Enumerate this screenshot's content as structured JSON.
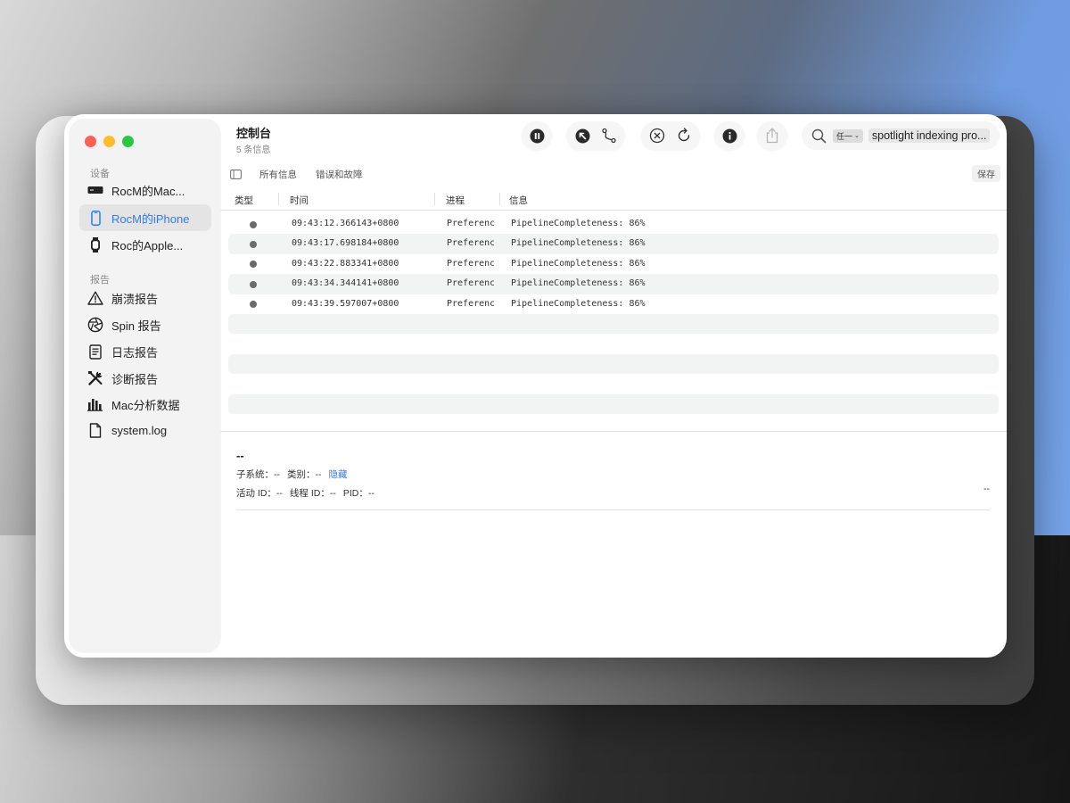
{
  "window": {
    "title": "控制台",
    "subtitle": "5 条信息"
  },
  "sidebar": {
    "section_devices": "设备",
    "devices": [
      {
        "label": "RocM的Mac...",
        "icon": "mac-mini-icon"
      },
      {
        "label": "RocM的iPhone",
        "icon": "iphone-icon",
        "active": true
      },
      {
        "label": "Roc的Apple...",
        "icon": "apple-watch-icon"
      }
    ],
    "section_reports": "报告",
    "reports": [
      {
        "label": "崩溃报告",
        "icon": "warning-triangle-icon"
      },
      {
        "label": "Spin 报告",
        "icon": "aperture-icon"
      },
      {
        "label": "日志报告",
        "icon": "document-lines-icon"
      },
      {
        "label": "诊断报告",
        "icon": "tools-icon"
      },
      {
        "label": "Mac分析数据",
        "icon": "bar-chart-icon"
      },
      {
        "label": "system.log",
        "icon": "file-icon"
      }
    ]
  },
  "toolbar": {
    "icons": [
      "pause-icon",
      "arrow-up-left-icon",
      "route-icon",
      "clear-icon",
      "reload-icon",
      "info-icon",
      "share-icon"
    ],
    "search": {
      "scope": "任一",
      "token": "spotlight indexing pro..."
    }
  },
  "filterbar": {
    "all_messages": "所有信息",
    "errors_faults": "错误和故障",
    "save": "保存"
  },
  "columns": {
    "type": "类型",
    "time": "时间",
    "process": "进程",
    "message": "信息"
  },
  "log_rows": [
    {
      "time": "09:43:12.366143+0800",
      "process": "Preferences",
      "message": "PipelineCompleteness: 86%"
    },
    {
      "time": "09:43:17.698184+0800",
      "process": "Preferences",
      "message": "PipelineCompleteness: 86%"
    },
    {
      "time": "09:43:22.883341+0800",
      "process": "Preferences",
      "message": "PipelineCompleteness: 86%"
    },
    {
      "time": "09:43:34.344141+0800",
      "process": "Preferences",
      "message": "PipelineCompleteness: 86%"
    },
    {
      "time": "09:43:39.597007+0800",
      "process": "Preferences",
      "message": "PipelineCompleteness: 86%"
    }
  ],
  "detail": {
    "title": "--",
    "subsystem_label": "子系统：--",
    "category_label": "类别：--",
    "hide_link": "隐藏",
    "activity_label": "活动 ID：--",
    "thread_label": "线程 ID：--",
    "pid_label": "PID：--",
    "right_value": "--"
  },
  "colors": {
    "accent": "#2f7bf5",
    "close": "#fe5f57",
    "minimize": "#febc2e",
    "zoom": "#28c840"
  }
}
